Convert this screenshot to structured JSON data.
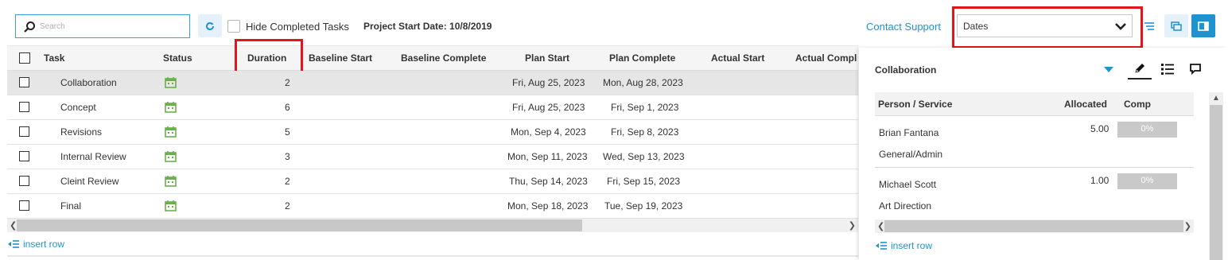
{
  "toolbar": {
    "search_placeholder": "Search",
    "hide_completed_label": "Hide Completed Tasks",
    "project_start": "Project Start Date: 10/8/2019",
    "contact_support": "Contact Support",
    "view_select_value": "Dates"
  },
  "grid": {
    "columns": [
      "Task",
      "Status",
      "Duration",
      "Baseline Start",
      "Baseline Complete",
      "Plan Start",
      "Plan Complete",
      "Actual Start",
      "Actual Compl"
    ],
    "rows": [
      {
        "task": "Collaboration",
        "duration": "2",
        "plan_start": "Fri, Aug 25, 2023",
        "plan_complete": "Mon, Aug 28, 2023",
        "selected": true
      },
      {
        "task": "Concept",
        "duration": "6",
        "plan_start": "Fri, Aug 25, 2023",
        "plan_complete": "Fri, Sep 1, 2023",
        "selected": false
      },
      {
        "task": "Revisions",
        "duration": "5",
        "plan_start": "Mon, Sep 4, 2023",
        "plan_complete": "Fri, Sep 8, 2023",
        "selected": false
      },
      {
        "task": "Internal Review",
        "duration": "3",
        "plan_start": "Mon, Sep 11, 2023",
        "plan_complete": "Wed, Sep 13, 2023",
        "selected": false
      },
      {
        "task": "Cleint Review",
        "duration": "2",
        "plan_start": "Thu, Sep 14, 2023",
        "plan_complete": "Fri, Sep 15, 2023",
        "selected": false
      },
      {
        "task": "Final",
        "duration": "2",
        "plan_start": "Mon, Sep 18, 2023",
        "plan_complete": "Tue, Sep 19, 2023",
        "selected": false
      }
    ],
    "insert_row_label": "insert row"
  },
  "panel": {
    "title": "Collaboration",
    "columns": [
      "Person / Service",
      "Allocated",
      "Comp"
    ],
    "rows": [
      {
        "person": "Brian Fantana",
        "service": "General/Admin",
        "allocated": "5.00",
        "complete": "0%"
      },
      {
        "person": "Michael Scott",
        "service": "Art Direction",
        "allocated": "1.00",
        "complete": "0%"
      }
    ],
    "insert_row_label": "insert row"
  },
  "colors": {
    "accent": "#1f93cf",
    "highlight": "#e3141a",
    "status_green": "#6ab04c"
  }
}
